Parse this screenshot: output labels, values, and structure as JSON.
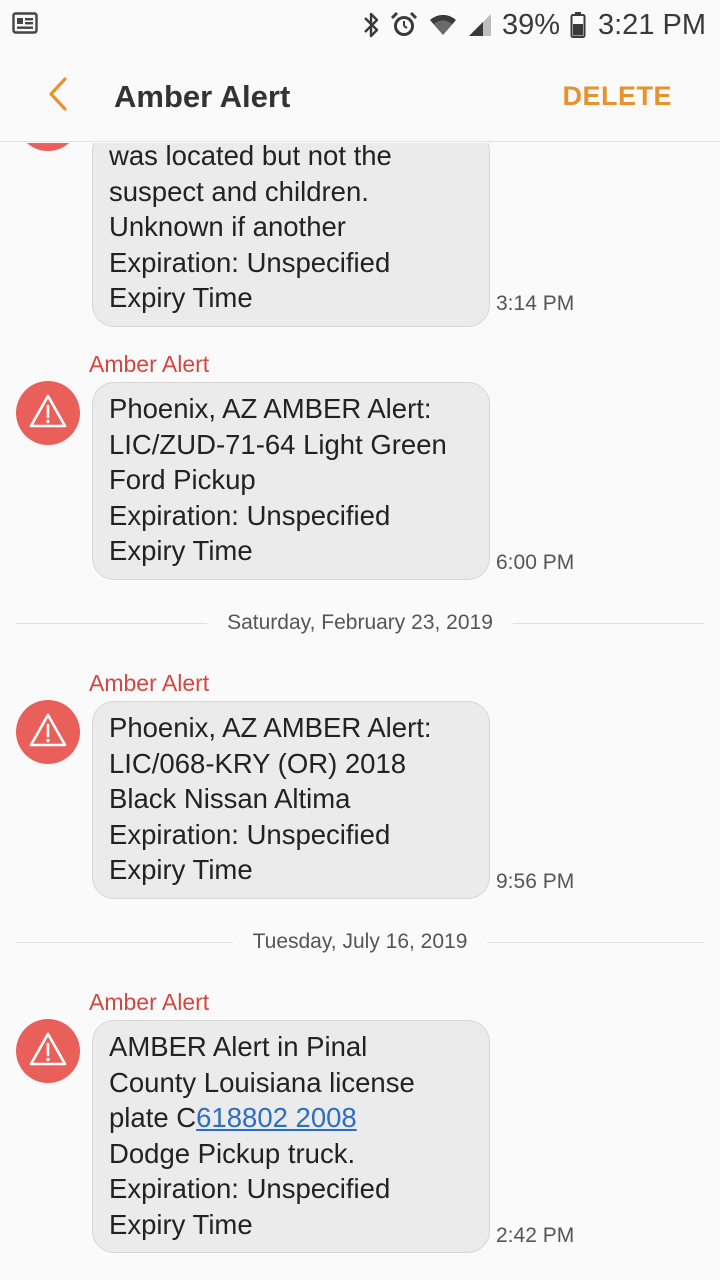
{
  "status_bar": {
    "battery_percent": "39%",
    "time": "3:21 PM",
    "icons": [
      "notification-icon",
      "bluetooth-icon",
      "alarm-icon",
      "wifi-icon",
      "signal-icon",
      "battery-icon"
    ]
  },
  "app_bar": {
    "title": "Amber Alert",
    "delete_label": "DELETE",
    "accent_color": "#e6922f"
  },
  "messages": [
    {
      "sender": "",
      "text": "was located but not the\nsuspect and children.\nUnknown if another\nExpiration: Unspecified\nExpiry Time",
      "time": "3:14 PM"
    },
    {
      "sender": "Amber Alert",
      "text": "Phoenix, AZ AMBER Alert:\nLIC/ZUD-71-64 Light Green\nFord Pickup\nExpiration: Unspecified\nExpiry Time",
      "time": "6:00 PM"
    },
    {
      "date": "Saturday, February 23, 2019"
    },
    {
      "sender": "Amber Alert",
      "text": "Phoenix, AZ AMBER Alert:\nLIC/068-KRY (OR) 2018\nBlack Nissan Altima\nExpiration: Unspecified\nExpiry Time",
      "time": "9:56 PM"
    },
    {
      "date": "Tuesday, July 16, 2019"
    },
    {
      "sender": "Amber Alert",
      "text_before_link": "AMBER Alert in Pinal\nCounty Louisiana license\nplate C",
      "link_text": "618802 2008",
      "text_after_link": "\nDodge Pickup truck.\nExpiration: Unspecified\nExpiry Time",
      "time": "2:42 PM"
    }
  ],
  "colors": {
    "alert_red": "#e9605a",
    "sender_red": "#d2473f",
    "bubble_bg": "#ebebeb",
    "link_blue": "#2a6fc1"
  }
}
